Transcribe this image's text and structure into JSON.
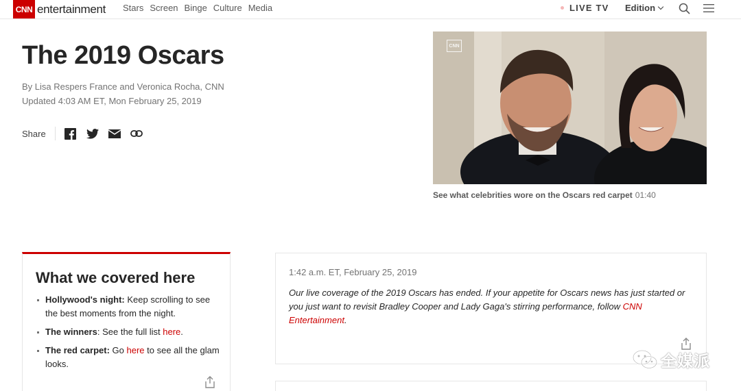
{
  "header": {
    "logo_mark": "CNN",
    "logo_word": "entertainment",
    "nav": [
      "Stars",
      "Screen",
      "Binge",
      "Culture",
      "Media"
    ],
    "live_tv": "LIVE TV",
    "edition": "Edition"
  },
  "article": {
    "title": "The 2019 Oscars",
    "byline": "By Lisa Respers France and Veronica Rocha, CNN",
    "updated": "Updated 4:03 AM ET, Mon February 25, 2019",
    "share_label": "Share"
  },
  "video": {
    "overlay_mark": "CNN",
    "caption": "See what celebrities wore on the Oscars red carpet",
    "duration": "01:40"
  },
  "covered": {
    "heading": "What we covered here",
    "items": [
      {
        "bold": "Hollywood's night:",
        "text": " Keep scrolling to see the best moments from the night."
      },
      {
        "bold": "The winners",
        "text": ": See the full list ",
        "link": "here",
        "after": "."
      },
      {
        "bold": "The red carpet:",
        "text": " Go ",
        "link": "here",
        "after": " to see all the glam looks."
      }
    ]
  },
  "post": {
    "timestamp": "1:42 a.m. ET, February 25, 2019",
    "body": "Our live coverage of the 2019 Oscars has ended. If your appetite for Oscars news has just started or you just want to revisit Bradley Cooper and Lady Gaga's stirring performance, follow ",
    "link": "CNN Entertainment",
    "after": "."
  },
  "watermark": {
    "text": "全媒派"
  },
  "colors": {
    "brand": "#cc0000",
    "text": "#262626",
    "muted": "#737373"
  }
}
